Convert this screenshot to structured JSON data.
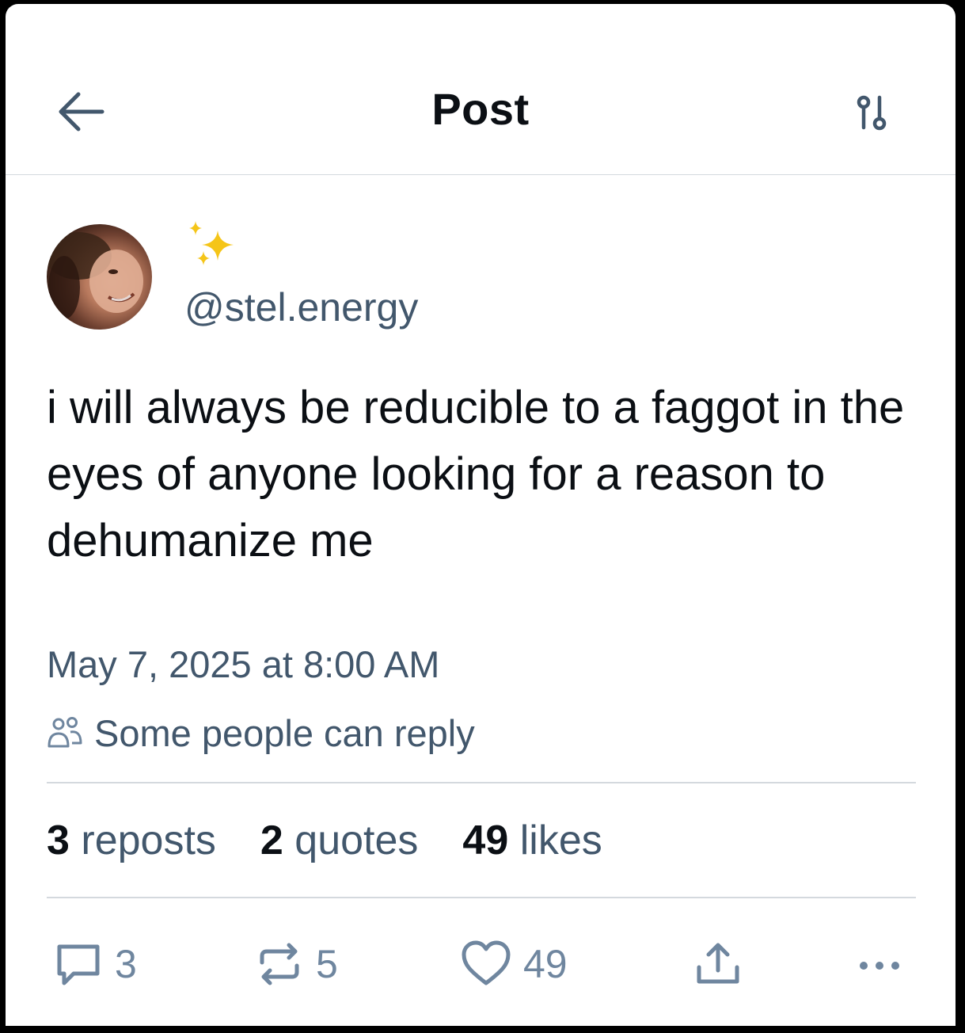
{
  "header": {
    "title": "Post"
  },
  "author": {
    "display_name_emoji": "sparkles",
    "handle": "@stel.energy"
  },
  "post": {
    "text": "i will always be reducible to a faggot in the eyes of anyone looking for a reason to dehumanize me",
    "timestamp": "May 7, 2025 at 8:00 AM",
    "reply_setting": "Some people can reply"
  },
  "stats": {
    "reposts_count": "3",
    "reposts_label": "reposts",
    "quotes_count": "2",
    "quotes_label": "quotes",
    "likes_count": "49",
    "likes_label": "likes"
  },
  "actions": {
    "reply_count": "3",
    "repost_count": "5",
    "like_count": "49"
  },
  "colors": {
    "text_primary": "#0b0f14",
    "text_secondary": "#42576c",
    "icon_muted": "#6f869f",
    "divider": "#d4d9de",
    "sparkle": "#f5c518"
  }
}
